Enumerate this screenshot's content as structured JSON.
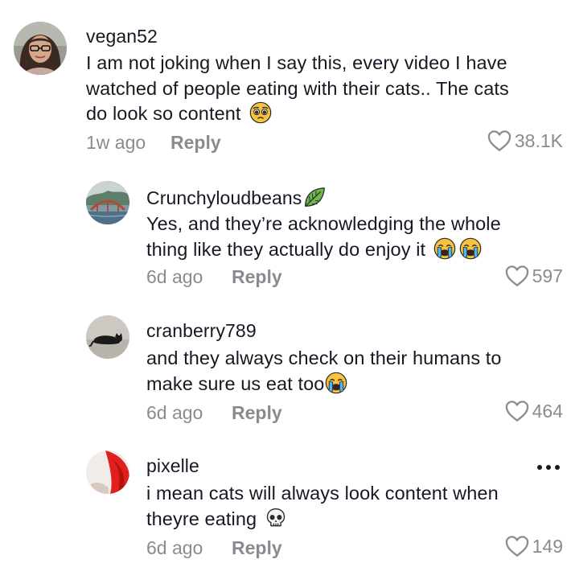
{
  "comments": [
    {
      "username": "vegan52",
      "text_lines": [
        "I am not joking when I say this, every video I have",
        "watched of people eating with their cats.. The cats",
        "do look so content"
      ],
      "emoji": "pleading-face-icon",
      "time": "1w ago",
      "reply_label": "Reply",
      "likes": "38.1K"
    },
    {
      "username": "Crunchyloudbeans",
      "badge": "leaf-icon",
      "text_lines": [
        "Yes, and they’re acknowledging the whole",
        "thing like they actually do enjoy it"
      ],
      "emoji": "crying-face-icon",
      "time": "6d ago",
      "reply_label": "Reply",
      "likes": "597"
    },
    {
      "username": "cranberry789",
      "text_lines": [
        "and they always check on their humans to",
        "make sure us eat too"
      ],
      "emoji": "crying-face-icon",
      "time": "6d ago",
      "reply_label": "Reply",
      "likes": "464"
    },
    {
      "username": "pixelle",
      "text_lines": [
        "i mean cats will always look content when",
        "theyre eating"
      ],
      "emoji": "skull-icon",
      "time": "6d ago",
      "reply_label": "Reply",
      "likes": "149"
    }
  ],
  "colors": {
    "text": "#161823",
    "secondary": "#8a8b91"
  }
}
